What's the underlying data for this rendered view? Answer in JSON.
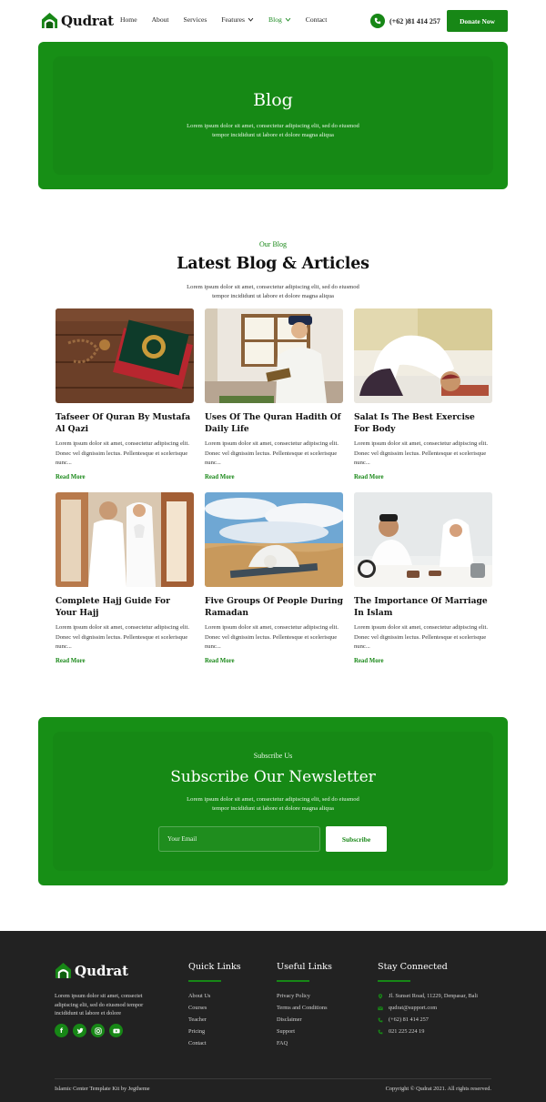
{
  "brand": {
    "name": "Qudrat",
    "accent": "#178716",
    "logo_icon": "mosque-icon"
  },
  "nav": {
    "items": [
      {
        "label": "Home"
      },
      {
        "label": "About"
      },
      {
        "label": "Services"
      },
      {
        "label": "Features",
        "has_dropdown": true
      },
      {
        "label": "Blog",
        "has_dropdown": true,
        "active": true
      },
      {
        "label": "Contact"
      }
    ],
    "phone": "(+62 )81 414 257",
    "phone_icon": "phone-icon",
    "donate_label": "Donate Now"
  },
  "hero": {
    "title": "Blog",
    "line1": "Lorem ipsum dolor sit amet, consectetur adipiscing elit, sed do eiusmod",
    "line2": "tempor incididunt ut labore et dolore magna aliqua"
  },
  "blog": {
    "eyebrow": "Our Blog",
    "title": "Latest Blog & Articles",
    "line1": "Lorem ipsum dolor sit amet, consectetur adipiscing elit, sed do eiusmod",
    "line2": "tempor incididunt ut labore et dolore magna aliqua",
    "read_more": "Read More",
    "excerpt": "Lorem ipsum dolor sit amet, consectetur adipiscing elit. Donec vel dignissim lectus. Pellentesque et scelerisque nunc...",
    "posts": [
      {
        "title": "Tafseer Of Quran By Mustafa Al Qazi",
        "image": "quran-book-photo"
      },
      {
        "title": "Uses Of The Quran Hadith Of Daily Life",
        "image": "man-reading-photo"
      },
      {
        "title": "Salat Is The Best Exercise For Body",
        "image": "man-praying-photo"
      },
      {
        "title": "Complete Hajj Guide For Your Hajj",
        "image": "couple-praying-photo"
      },
      {
        "title": "Five Groups Of People During Ramadan",
        "image": "desert-prayer-photo"
      },
      {
        "title": "The Importance Of Marriage In Islam",
        "image": "couple-table-photo"
      }
    ]
  },
  "newsletter": {
    "eyebrow": "Subscribe Us",
    "title": "Subscribe Our Newsletter",
    "line1": "Lorem ipsum dolor sit amet, consectetur adipiscing elit, sed do eiusmod",
    "line2": "tempor incididunt ut labore et dolore magna aliqua",
    "email_placeholder": "Your Email",
    "button": "Subscribe"
  },
  "footer": {
    "about": "Lorem ipsum dolor sit amet, consectet adipiscing elit, sed do eiusmod tempor incididunt ut labore et dolore",
    "socials": [
      "facebook-icon",
      "twitter-icon",
      "instagram-icon",
      "youtube-icon"
    ],
    "quick_links": {
      "title": "Quick Links",
      "items": [
        "About Us",
        "Courses",
        "Teacher",
        "Pricing",
        "Contact"
      ]
    },
    "useful_links": {
      "title": "Useful Links",
      "items": [
        "Privacy Policy",
        "Terms and Conditions",
        "Disclaimer",
        "Support",
        "FAQ"
      ]
    },
    "stay_connected": {
      "title": "Stay Connected",
      "items": [
        {
          "icon": "location-pin-icon",
          "text": "Jl. Sunset Road, 11229, Denpasar, Bali"
        },
        {
          "icon": "mail-icon",
          "text": "qudrat@support.com"
        },
        {
          "icon": "phone-icon",
          "text": "(+62) 81 414 257"
        },
        {
          "icon": "phone-icon",
          "text": "021 225 224 19"
        }
      ]
    },
    "credit": "Islamic Center Template Kit by Jegtheme",
    "copyright": "Copyright © Qudrat 2021. All rights reserved."
  }
}
